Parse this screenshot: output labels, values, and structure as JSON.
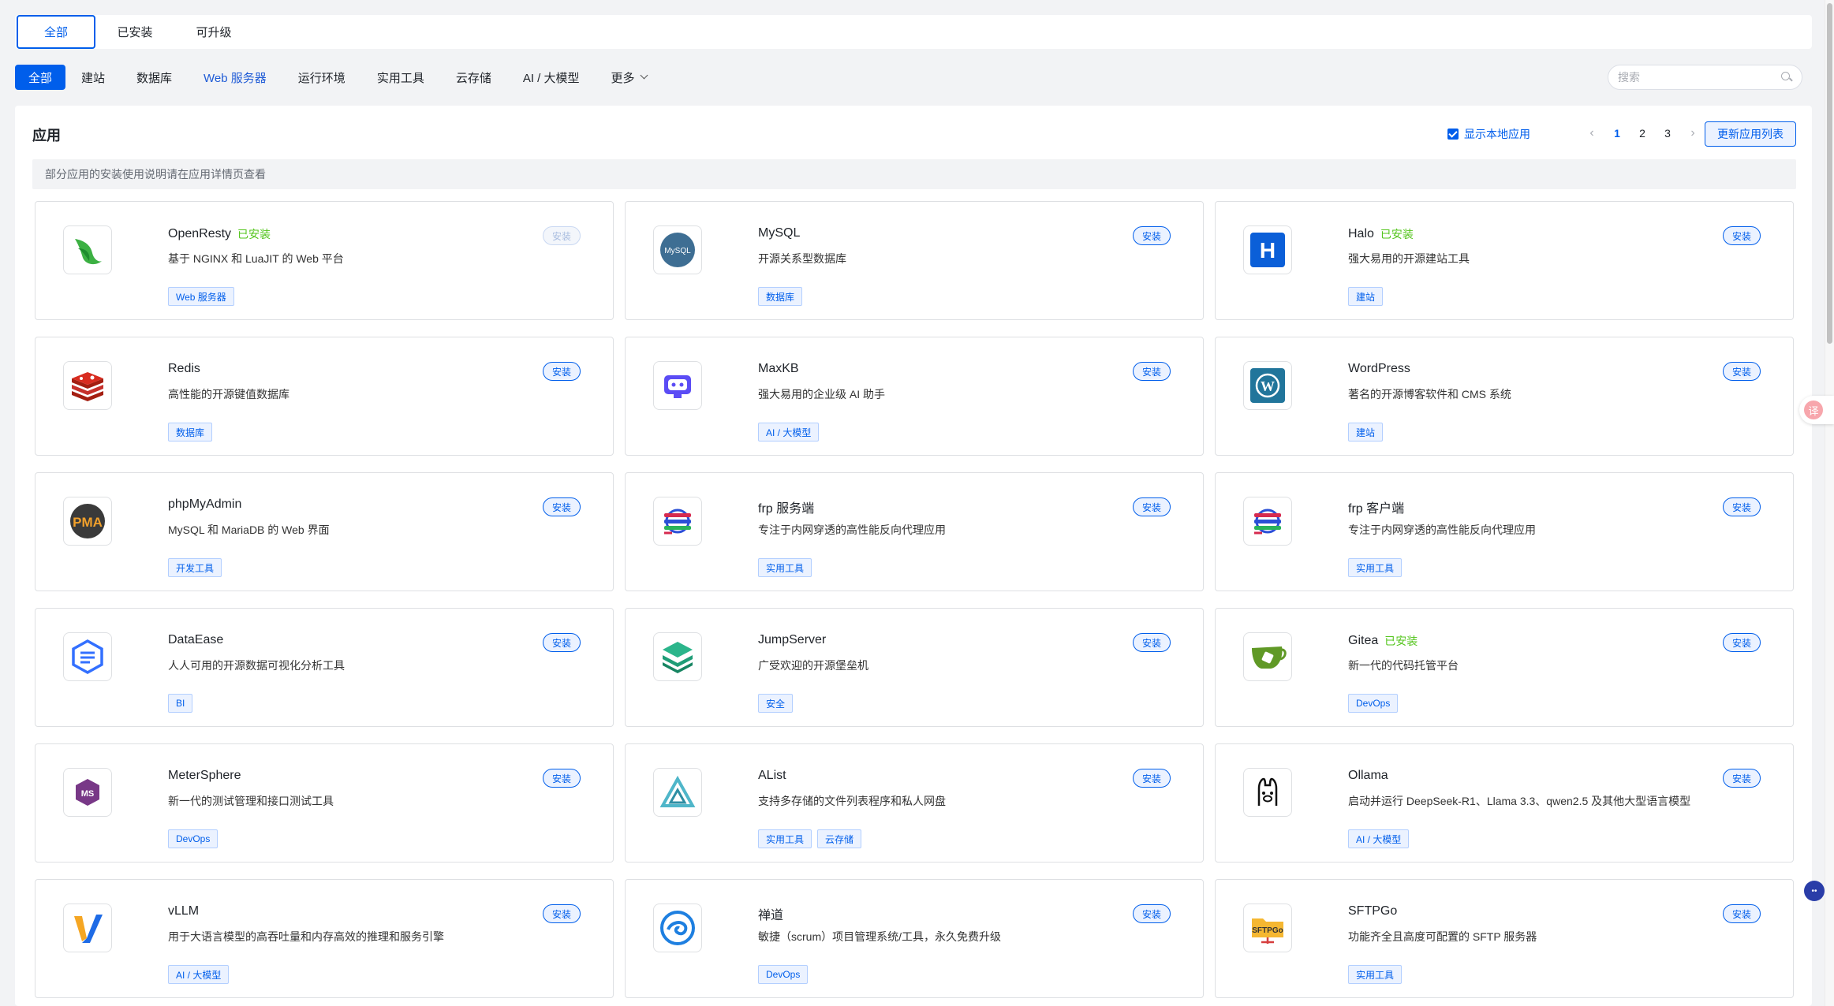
{
  "top_tabs": [
    {
      "label": "全部",
      "active": true
    },
    {
      "label": "已安装",
      "active": false
    },
    {
      "label": "可升级",
      "active": false
    }
  ],
  "categories": [
    {
      "label": "全部",
      "active": true
    },
    {
      "label": "建站"
    },
    {
      "label": "数据库"
    },
    {
      "label": "Web 服务器",
      "link": true
    },
    {
      "label": "运行环境"
    },
    {
      "label": "实用工具"
    },
    {
      "label": "云存储"
    },
    {
      "label": "AI / 大模型"
    },
    {
      "label": "更多"
    }
  ],
  "search": {
    "placeholder": "搜索"
  },
  "panel": {
    "title": "应用",
    "show_local_label": "显示本地应用",
    "show_local_checked": true,
    "pages": [
      "1",
      "2",
      "3"
    ],
    "current_page": "1",
    "update_button": "更新应用列表",
    "notice": "部分应用的安装使用说明请在应用详情页查看"
  },
  "install_label": "安装",
  "installed_label": "已安装",
  "apps": [
    {
      "name": "OpenResty",
      "installed": true,
      "desc": "基于 NGINX 和 LuaJIT 的 Web 平台",
      "tags": [
        "Web 服务器"
      ],
      "icon": "openresty-logo-icon",
      "install_disabled": true
    },
    {
      "name": "MySQL",
      "installed": false,
      "desc": "开源关系型数据库",
      "tags": [
        "数据库"
      ],
      "icon": "mysql-logo-icon"
    },
    {
      "name": "Halo",
      "installed": true,
      "desc": "强大易用的开源建站工具",
      "tags": [
        "建站"
      ],
      "icon": "halo-logo-icon"
    },
    {
      "name": "Redis",
      "installed": false,
      "desc": "高性能的开源键值数据库",
      "tags": [
        "数据库"
      ],
      "icon": "redis-logo-icon"
    },
    {
      "name": "MaxKB",
      "installed": false,
      "desc": "强大易用的企业级 AI 助手",
      "tags": [
        "AI / 大模型"
      ],
      "icon": "maxkb-logo-icon"
    },
    {
      "name": "WordPress",
      "installed": false,
      "desc": "著名的开源博客软件和 CMS 系统",
      "tags": [
        "建站"
      ],
      "icon": "wordpress-logo-icon"
    },
    {
      "name": "phpMyAdmin",
      "installed": false,
      "desc": "MySQL 和 MariaDB 的 Web 界面",
      "tags": [
        "开发工具"
      ],
      "icon": "phpmyadmin-logo-icon"
    },
    {
      "name": "frp 服务端",
      "installed": false,
      "desc": "专注于内网穿透的高性能反向代理应用",
      "tags": [
        "实用工具"
      ],
      "icon": "frp-logo-icon"
    },
    {
      "name": "frp 客户端",
      "installed": false,
      "desc": "专注于内网穿透的高性能反向代理应用",
      "tags": [
        "实用工具"
      ],
      "icon": "frp-logo-icon"
    },
    {
      "name": "DataEase",
      "installed": false,
      "desc": "人人可用的开源数据可视化分析工具",
      "tags": [
        "BI"
      ],
      "icon": "dataease-logo-icon"
    },
    {
      "name": "JumpServer",
      "installed": false,
      "desc": "广受欢迎的开源堡垒机",
      "tags": [
        "安全"
      ],
      "icon": "jumpserver-logo-icon"
    },
    {
      "name": "Gitea",
      "installed": true,
      "desc": "新一代的代码托管平台",
      "tags": [
        "DevOps"
      ],
      "icon": "gitea-logo-icon"
    },
    {
      "name": "MeterSphere",
      "installed": false,
      "desc": "新一代的测试管理和接口测试工具",
      "tags": [
        "DevOps"
      ],
      "icon": "metersphere-logo-icon"
    },
    {
      "name": "AList",
      "installed": false,
      "desc": "支持多存储的文件列表程序和私人网盘",
      "tags": [
        "实用工具",
        "云存储"
      ],
      "icon": "alist-logo-icon"
    },
    {
      "name": "Ollama",
      "installed": false,
      "desc": "启动并运行 DeepSeek-R1、Llama 3.3、qwen2.5 及其他大型语言模型",
      "tags": [
        "AI / 大模型"
      ],
      "icon": "ollama-logo-icon"
    },
    {
      "name": "vLLM",
      "installed": false,
      "desc": "用于大语言模型的高吞吐量和内存高效的推理和服务引擎",
      "tags": [
        "AI / 大模型"
      ],
      "icon": "vllm-logo-icon"
    },
    {
      "name": "禅道",
      "installed": false,
      "desc": "敏捷（scrum）项目管理系统/工具，永久免费升级",
      "tags": [
        "DevOps"
      ],
      "icon": "zentao-logo-icon"
    },
    {
      "name": "SFTPGo",
      "installed": false,
      "desc": "功能齐全且高度可配置的 SFTP 服务器",
      "tags": [
        "实用工具"
      ],
      "icon": "sftpgo-logo-icon"
    }
  ],
  "icon_texts": {
    "mysql": "MySQL",
    "halo": "H",
    "phpmyadmin": "PMA",
    "sftpgo": "SFTPGo"
  },
  "floaters": {
    "translate": "译",
    "bot": "••"
  },
  "colors": {
    "accent": "#005eeb",
    "installed": "#52c41a"
  }
}
